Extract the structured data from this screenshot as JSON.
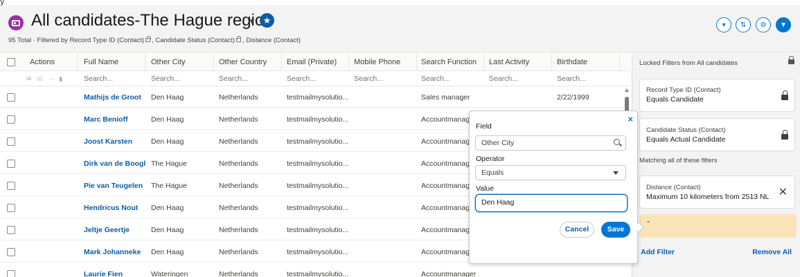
{
  "header": {
    "title": "All candidates-The Hague region",
    "subtitle_parts": [
      "95 Total · Filtered by Record Type ID (Contact)",
      ", Candidate Status (Contact)",
      ", Distance (Contact)"
    ]
  },
  "top_fragment": "y",
  "columns": [
    "Actions",
    "Full Name",
    "Other City",
    "Other Country",
    "Email (Private)",
    "Mobile Phone",
    "Search Function",
    "Last Activity",
    "Birthdate"
  ],
  "search_placeholder": "Search...",
  "action_icons": "✉ ☏ ⋯ ▮",
  "rows": [
    {
      "name": "Mathijs de Groot",
      "city": "Den Haag",
      "country": "Netherlands",
      "email": "testmailmysolutio...",
      "mobile": "",
      "function": "Sales manager",
      "last_activity": "",
      "birthdate": "2/22/1999"
    },
    {
      "name": "Marc Benioff",
      "city": "Den Haag",
      "country": "Netherlands",
      "email": "testmailmysolutio...",
      "mobile": "",
      "function": "Accountmanager",
      "last_activity": "",
      "birthdate": ""
    },
    {
      "name": "Joost Karsten",
      "city": "Den Haag",
      "country": "Netherlands",
      "email": "testmailmysolutio...",
      "mobile": "",
      "function": "Accountmanager",
      "last_activity": "",
      "birthdate": ""
    },
    {
      "name": "Dirk van de Booghaard",
      "city": "The Hague",
      "country": "Netherlands",
      "email": "testmailmysolutio...",
      "mobile": "",
      "function": "Accountmanager",
      "last_activity": "",
      "birthdate": ""
    },
    {
      "name": "Pie van Teugelen",
      "city": "The Hague",
      "country": "Netherlands",
      "email": "testmailmysolutio...",
      "mobile": "",
      "function": "Accountmanager",
      "last_activity": "",
      "birthdate": ""
    },
    {
      "name": "Hendricus Nout",
      "city": "Den Haag",
      "country": "Netherlands",
      "email": "testmailmysolutio...",
      "mobile": "",
      "function": "Accountmanager",
      "last_activity": "",
      "birthdate": ""
    },
    {
      "name": "Jeltje Geertje",
      "city": "Den Haag",
      "country": "Netherlands",
      "email": "testmailmysolutio...",
      "mobile": "",
      "function": "Accountmanager",
      "last_activity": "",
      "birthdate": ""
    },
    {
      "name": "Mark Johanneke",
      "city": "Den Haag",
      "country": "Netherlands",
      "email": "testmailmysolutio...",
      "mobile": "",
      "function": "Accountmanager",
      "last_activity": "",
      "birthdate": ""
    },
    {
      "name": "Laurie Fien",
      "city": "Wateringen",
      "country": "Netherlands",
      "email": "testmailmysolutio...",
      "mobile": "",
      "function": "Accountmanager",
      "last_activity": "",
      "birthdate": ""
    }
  ],
  "filter_panel": {
    "locked_title": "Locked Filters from All candidates",
    "locked_filters": [
      {
        "label": "Record Type ID (Contact)",
        "value": "Equals Candidate"
      },
      {
        "label": "Candidate Status (Contact)",
        "value": "Equals Actual Candidate"
      }
    ],
    "matching_label": "Matching all of these filters",
    "filters": [
      {
        "label": "Distance (Contact)",
        "value": "Maximum 10 kilometers from 2513 NL"
      }
    ],
    "new_filter_text": "-",
    "add_filter": "Add Filter",
    "remove_all": "Remove All"
  },
  "popover": {
    "close": "×",
    "field_label": "Field",
    "field_value": "Other City",
    "operator_label": "Operator",
    "operator_value": "Equals",
    "value_label": "Value",
    "value_value": "Den Haag",
    "cancel_label": "Cancel",
    "save_label": "Save"
  },
  "colors": {
    "brand_blue": "#0176d3",
    "link_blue": "#0b5cab",
    "object_icon": "#9a2fa2",
    "new_filter_bg": "#fae3b6"
  },
  "icons": {
    "star": "★",
    "title_caret": "▼",
    "header_buttons": [
      "▾",
      "⇅",
      "⚙",
      "▼"
    ]
  }
}
